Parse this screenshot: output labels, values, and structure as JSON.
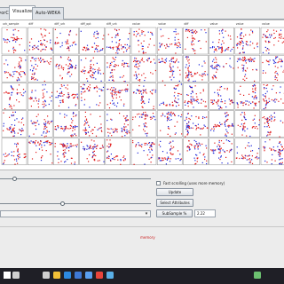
{
  "tabs": [
    {
      "label": "ssifyorClusters",
      "active": false
    },
    {
      "label": "Visualize",
      "active": true
    },
    {
      "label": "Auto-WEKA",
      "active": false
    }
  ],
  "matrix": {
    "rows": 5,
    "cols": 11,
    "colors": {
      "class_a": "#e01818",
      "class_b": "#1c24d8",
      "grid": "#8a8a8a",
      "header": "#3a3a3a"
    },
    "column_headers": [
      "urk_sample",
      "diff",
      "diff_urk",
      "diff_opt",
      "diff_urk",
      "value",
      "value",
      "diff",
      "value",
      "value",
      "value"
    ]
  },
  "controls": {
    "fast_scrolling_label": "Fast scrolling (uses more memory)",
    "fast_scrolling_checked": false,
    "update_label": "Update",
    "select_attributes_label": "Select Attributes",
    "subsample_label": "SubSample %",
    "subsample_value": "2.22",
    "combo_arrow": "▾",
    "plot_size_level": 0.08,
    "point_size_level": 0.4,
    "status_text": "memory"
  },
  "taskbar": {
    "items": [
      "windows-icon",
      "search-icon",
      "task-view-icon",
      "file-explorer-icon",
      "edge-icon",
      "mail-icon",
      "store-icon",
      "chrome-icon",
      "weka-icon",
      "app-icon"
    ]
  }
}
